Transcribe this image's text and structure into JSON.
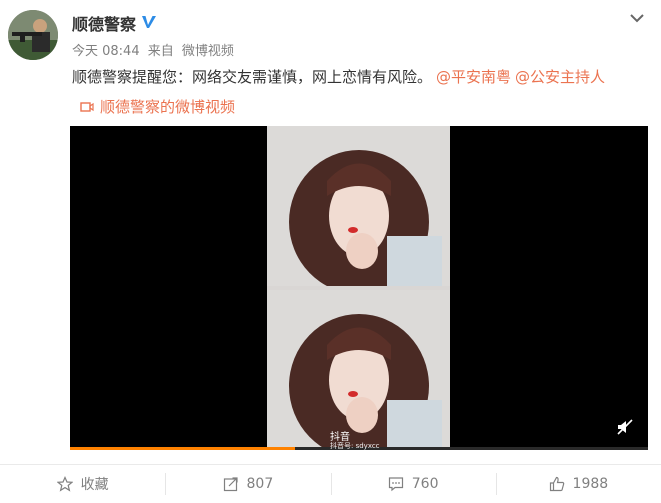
{
  "post": {
    "author_name": "顺德警察",
    "time": "今天 08:44",
    "source_prefix": "来自",
    "source": "微博视频",
    "text": "顺德警察提醒您：网络交友需谨慎，网上恋情有风险。",
    "mentions": [
      "@平安南粤",
      "@公安主持人"
    ],
    "video_link": "顺德警察的微博视频"
  },
  "video": {
    "watermark": "抖音",
    "watermark_id": "抖音号: sdyxcc",
    "progress": 0.39
  },
  "actions": {
    "favorite_label": "收藏",
    "repost_count": "807",
    "comment_count": "760",
    "like_count": "1988"
  },
  "colors": {
    "accent": "#eb7350",
    "verified": "#2d8ce6",
    "progress": "#ff8200"
  },
  "icons": [
    "verified-icon",
    "chevron-down-icon",
    "video-link-icon",
    "mute-icon",
    "star-icon",
    "share-icon",
    "comment-icon",
    "thumbs-up-icon"
  ]
}
